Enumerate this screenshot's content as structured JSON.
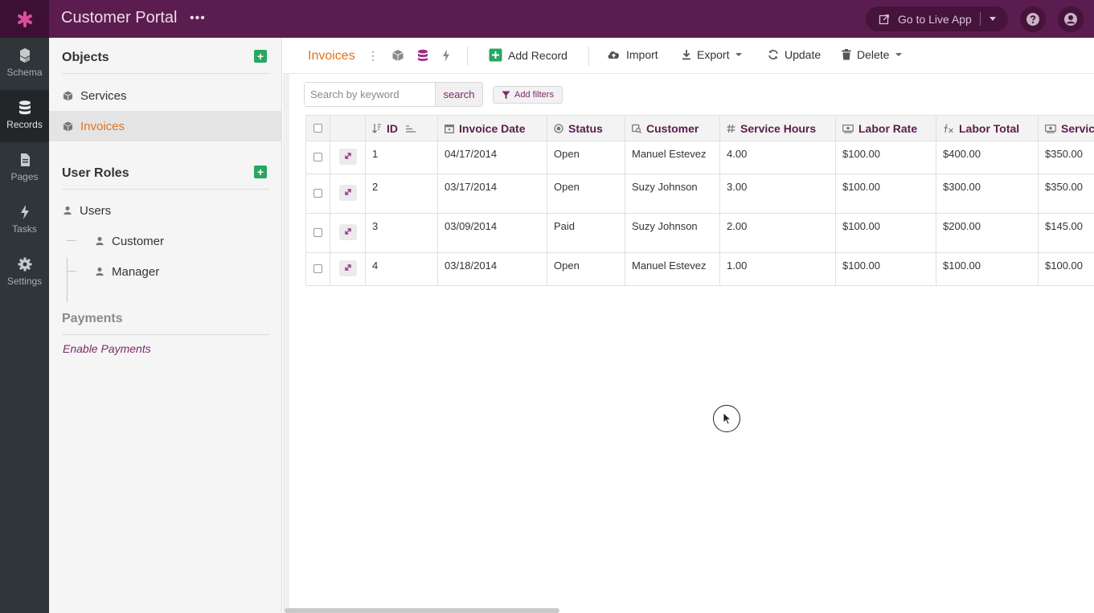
{
  "app": {
    "title": "Customer Portal",
    "menu_dots": "•••",
    "live_app_label": "Go to Live App",
    "colors": {
      "brand": "#5b1c4f",
      "accent": "#e1731f",
      "add_green": "#27a75f"
    }
  },
  "rail": {
    "items": [
      {
        "label": "Schema",
        "icon": "schema-icon"
      },
      {
        "label": "Records",
        "icon": "database-icon"
      },
      {
        "label": "Pages",
        "icon": "pages-icon"
      },
      {
        "label": "Tasks",
        "icon": "bolt-icon"
      },
      {
        "label": "Settings",
        "icon": "gear-icon"
      }
    ]
  },
  "panel": {
    "objects_heading": "Objects",
    "objects": [
      {
        "label": "Services"
      },
      {
        "label": "Invoices"
      }
    ],
    "roles_heading": "User Roles",
    "roles": [
      {
        "label": "Users"
      },
      {
        "label": "Customer"
      },
      {
        "label": "Manager"
      }
    ],
    "payments_heading": "Payments",
    "payments_link": "Enable Payments"
  },
  "toolbar": {
    "title": "Invoices",
    "kebab": "⋮",
    "add_record": "Add Record",
    "import": "Import",
    "export": "Export",
    "update": "Update",
    "delete": "Delete"
  },
  "search": {
    "placeholder": "Search by keyword",
    "button": "search",
    "filters": "Add filters"
  },
  "table": {
    "columns": [
      "ID",
      "Invoice Date",
      "Status",
      "Customer",
      "Service Hours",
      "Labor Rate",
      "Labor Total",
      "Servic"
    ],
    "rows": [
      [
        "1",
        "04/17/2014",
        "Open",
        "Manuel Estevez",
        "4.00",
        "$100.00",
        "$400.00",
        "$350.00"
      ],
      [
        "2",
        "03/17/2014",
        "Open",
        "Suzy Johnson",
        "3.00",
        "$100.00",
        "$300.00",
        "$350.00"
      ],
      [
        "3",
        "03/09/2014",
        "Paid",
        "Suzy Johnson",
        "2.00",
        "$100.00",
        "$200.00",
        "$145.00"
      ],
      [
        "4",
        "03/18/2014",
        "Open",
        "Manuel Estevez",
        "1.00",
        "$100.00",
        "$100.00",
        "$100.00"
      ]
    ]
  }
}
